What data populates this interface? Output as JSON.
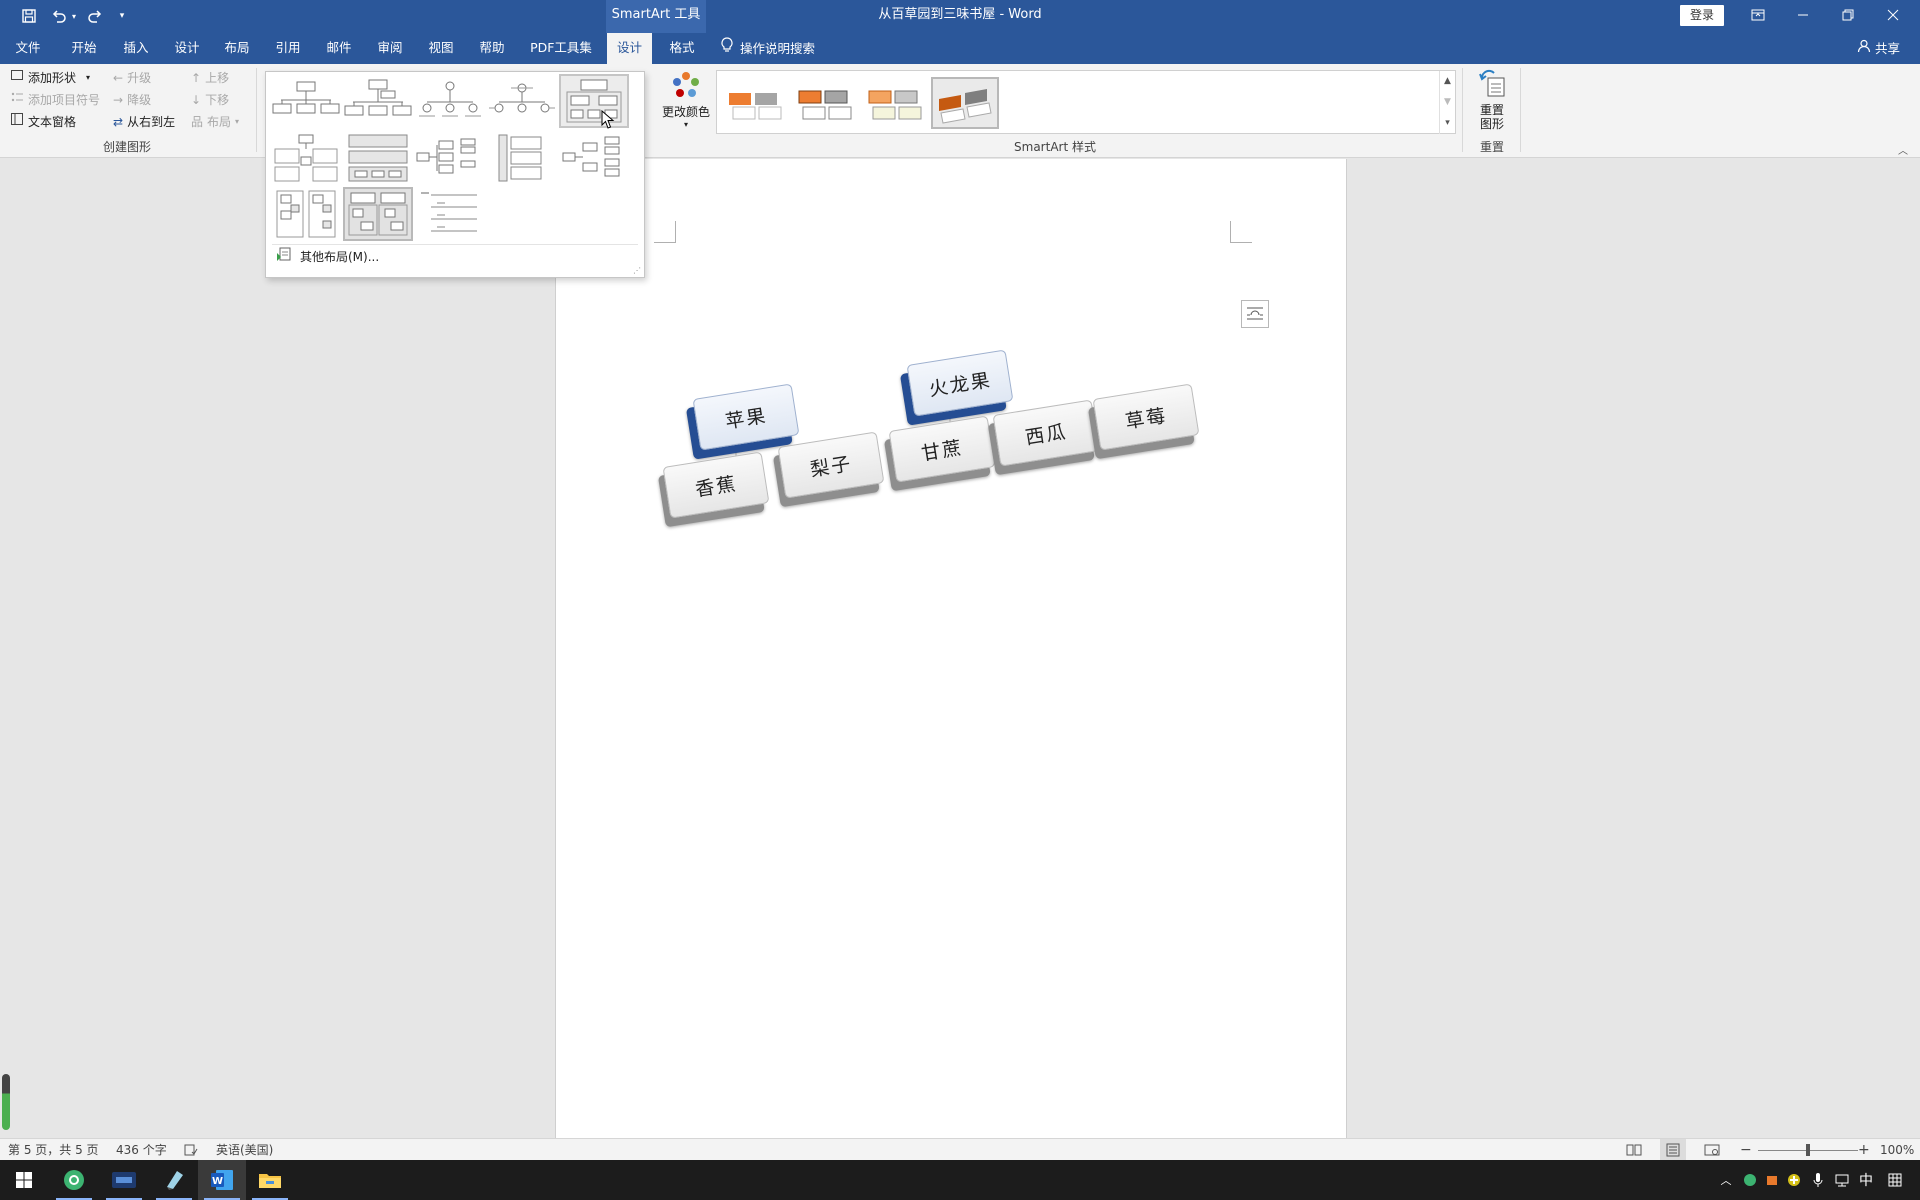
{
  "title_bar": {
    "context_tab": "SmartArt 工具",
    "document_title": "从百草园到三味书屋  -  Word",
    "login": "登录"
  },
  "tabs": [
    {
      "label": "文件"
    },
    {
      "label": "开始"
    },
    {
      "label": "插入"
    },
    {
      "label": "设计"
    },
    {
      "label": "布局"
    },
    {
      "label": "引用"
    },
    {
      "label": "邮件"
    },
    {
      "label": "审阅"
    },
    {
      "label": "视图"
    },
    {
      "label": "帮助"
    },
    {
      "label": "PDF工具集"
    },
    {
      "label": "设计"
    },
    {
      "label": "格式"
    }
  ],
  "active_tab_index": 11,
  "tell_me": "操作说明搜索",
  "share": "共享",
  "ribbon": {
    "create_graphic": {
      "add_shape": "添加形状",
      "add_bullet": "添加项目符号",
      "text_pane": "文本窗格",
      "promote": "升级",
      "demote": "降级",
      "right_to_left": "从右到左",
      "move_up": "上移",
      "move_down": "下移",
      "layout": "布局",
      "group_label": "创建图形"
    },
    "change_colors": "更改颜色",
    "styles_group_label": "SmartArt 样式",
    "reset_graphic": "重置图形",
    "reset_group_label": "重置"
  },
  "layout_dropdown": {
    "more_layouts": "其他布局(M)..."
  },
  "smartart": {
    "nodes": [
      {
        "text": "火龙果",
        "color": "#2a58a3"
      },
      {
        "text": "苹果",
        "color": "#2a58a3"
      },
      {
        "text": "香蕉",
        "color": "#8e8e8e"
      },
      {
        "text": "梨子",
        "color": "#8e8e8e"
      },
      {
        "text": "甘蔗",
        "color": "#8e8e8e"
      },
      {
        "text": "西瓜",
        "color": "#8e8e8e"
      },
      {
        "text": "草莓",
        "color": "#8e8e8e"
      }
    ]
  },
  "status_bar": {
    "page": "第 5 页，共 5 页",
    "words": "436 个字",
    "language": "英语(美国)",
    "zoom": "100%",
    "zoom_level": 1.0
  },
  "accent_color": "#2b579a"
}
